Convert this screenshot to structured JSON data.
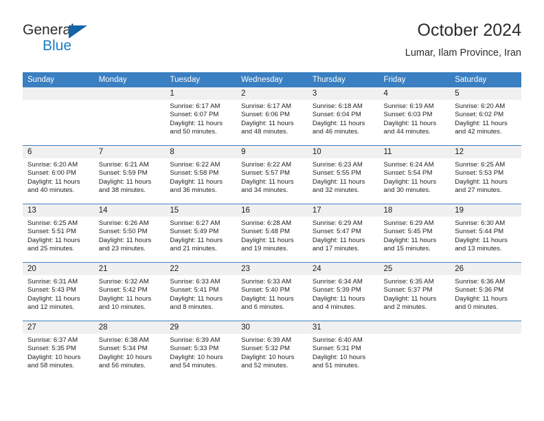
{
  "brand": {
    "name_top": "General",
    "name_bottom": "Blue",
    "triangle_color": "#1464aa",
    "blue_color": "#1a7dc8"
  },
  "header": {
    "title": "October 2024",
    "subtitle": "Lumar, Ilam Province, Iran"
  },
  "theme": {
    "header_bg": "#3a7fc1",
    "daynum_bg": "#f0f0f0",
    "grid_line": "#3a7fc1"
  },
  "weekdays": [
    "Sunday",
    "Monday",
    "Tuesday",
    "Wednesday",
    "Thursday",
    "Friday",
    "Saturday"
  ],
  "weeks": [
    [
      {
        "day": "",
        "empty": true
      },
      {
        "day": "",
        "empty": true
      },
      {
        "day": "1",
        "sunrise": "Sunrise: 6:17 AM",
        "sunset": "Sunset: 6:07 PM",
        "daylight": "Daylight: 11 hours and 50 minutes."
      },
      {
        "day": "2",
        "sunrise": "Sunrise: 6:17 AM",
        "sunset": "Sunset: 6:06 PM",
        "daylight": "Daylight: 11 hours and 48 minutes."
      },
      {
        "day": "3",
        "sunrise": "Sunrise: 6:18 AM",
        "sunset": "Sunset: 6:04 PM",
        "daylight": "Daylight: 11 hours and 46 minutes."
      },
      {
        "day": "4",
        "sunrise": "Sunrise: 6:19 AM",
        "sunset": "Sunset: 6:03 PM",
        "daylight": "Daylight: 11 hours and 44 minutes."
      },
      {
        "day": "5",
        "sunrise": "Sunrise: 6:20 AM",
        "sunset": "Sunset: 6:02 PM",
        "daylight": "Daylight: 11 hours and 42 minutes."
      }
    ],
    [
      {
        "day": "6",
        "sunrise": "Sunrise: 6:20 AM",
        "sunset": "Sunset: 6:00 PM",
        "daylight": "Daylight: 11 hours and 40 minutes."
      },
      {
        "day": "7",
        "sunrise": "Sunrise: 6:21 AM",
        "sunset": "Sunset: 5:59 PM",
        "daylight": "Daylight: 11 hours and 38 minutes."
      },
      {
        "day": "8",
        "sunrise": "Sunrise: 6:22 AM",
        "sunset": "Sunset: 5:58 PM",
        "daylight": "Daylight: 11 hours and 36 minutes."
      },
      {
        "day": "9",
        "sunrise": "Sunrise: 6:22 AM",
        "sunset": "Sunset: 5:57 PM",
        "daylight": "Daylight: 11 hours and 34 minutes."
      },
      {
        "day": "10",
        "sunrise": "Sunrise: 6:23 AM",
        "sunset": "Sunset: 5:55 PM",
        "daylight": "Daylight: 11 hours and 32 minutes."
      },
      {
        "day": "11",
        "sunrise": "Sunrise: 6:24 AM",
        "sunset": "Sunset: 5:54 PM",
        "daylight": "Daylight: 11 hours and 30 minutes."
      },
      {
        "day": "12",
        "sunrise": "Sunrise: 6:25 AM",
        "sunset": "Sunset: 5:53 PM",
        "daylight": "Daylight: 11 hours and 27 minutes."
      }
    ],
    [
      {
        "day": "13",
        "sunrise": "Sunrise: 6:25 AM",
        "sunset": "Sunset: 5:51 PM",
        "daylight": "Daylight: 11 hours and 25 minutes."
      },
      {
        "day": "14",
        "sunrise": "Sunrise: 6:26 AM",
        "sunset": "Sunset: 5:50 PM",
        "daylight": "Daylight: 11 hours and 23 minutes."
      },
      {
        "day": "15",
        "sunrise": "Sunrise: 6:27 AM",
        "sunset": "Sunset: 5:49 PM",
        "daylight": "Daylight: 11 hours and 21 minutes."
      },
      {
        "day": "16",
        "sunrise": "Sunrise: 6:28 AM",
        "sunset": "Sunset: 5:48 PM",
        "daylight": "Daylight: 11 hours and 19 minutes."
      },
      {
        "day": "17",
        "sunrise": "Sunrise: 6:29 AM",
        "sunset": "Sunset: 5:47 PM",
        "daylight": "Daylight: 11 hours and 17 minutes."
      },
      {
        "day": "18",
        "sunrise": "Sunrise: 6:29 AM",
        "sunset": "Sunset: 5:45 PM",
        "daylight": "Daylight: 11 hours and 15 minutes."
      },
      {
        "day": "19",
        "sunrise": "Sunrise: 6:30 AM",
        "sunset": "Sunset: 5:44 PM",
        "daylight": "Daylight: 11 hours and 13 minutes."
      }
    ],
    [
      {
        "day": "20",
        "sunrise": "Sunrise: 6:31 AM",
        "sunset": "Sunset: 5:43 PM",
        "daylight": "Daylight: 11 hours and 12 minutes."
      },
      {
        "day": "21",
        "sunrise": "Sunrise: 6:32 AM",
        "sunset": "Sunset: 5:42 PM",
        "daylight": "Daylight: 11 hours and 10 minutes."
      },
      {
        "day": "22",
        "sunrise": "Sunrise: 6:33 AM",
        "sunset": "Sunset: 5:41 PM",
        "daylight": "Daylight: 11 hours and 8 minutes."
      },
      {
        "day": "23",
        "sunrise": "Sunrise: 6:33 AM",
        "sunset": "Sunset: 5:40 PM",
        "daylight": "Daylight: 11 hours and 6 minutes."
      },
      {
        "day": "24",
        "sunrise": "Sunrise: 6:34 AM",
        "sunset": "Sunset: 5:39 PM",
        "daylight": "Daylight: 11 hours and 4 minutes."
      },
      {
        "day": "25",
        "sunrise": "Sunrise: 6:35 AM",
        "sunset": "Sunset: 5:37 PM",
        "daylight": "Daylight: 11 hours and 2 minutes."
      },
      {
        "day": "26",
        "sunrise": "Sunrise: 6:36 AM",
        "sunset": "Sunset: 5:36 PM",
        "daylight": "Daylight: 11 hours and 0 minutes."
      }
    ],
    [
      {
        "day": "27",
        "sunrise": "Sunrise: 6:37 AM",
        "sunset": "Sunset: 5:35 PM",
        "daylight": "Daylight: 10 hours and 58 minutes."
      },
      {
        "day": "28",
        "sunrise": "Sunrise: 6:38 AM",
        "sunset": "Sunset: 5:34 PM",
        "daylight": "Daylight: 10 hours and 56 minutes."
      },
      {
        "day": "29",
        "sunrise": "Sunrise: 6:39 AM",
        "sunset": "Sunset: 5:33 PM",
        "daylight": "Daylight: 10 hours and 54 minutes."
      },
      {
        "day": "30",
        "sunrise": "Sunrise: 6:39 AM",
        "sunset": "Sunset: 5:32 PM",
        "daylight": "Daylight: 10 hours and 52 minutes."
      },
      {
        "day": "31",
        "sunrise": "Sunrise: 6:40 AM",
        "sunset": "Sunset: 5:31 PM",
        "daylight": "Daylight: 10 hours and 51 minutes."
      },
      {
        "day": "",
        "empty": true
      },
      {
        "day": "",
        "empty": true
      }
    ]
  ]
}
